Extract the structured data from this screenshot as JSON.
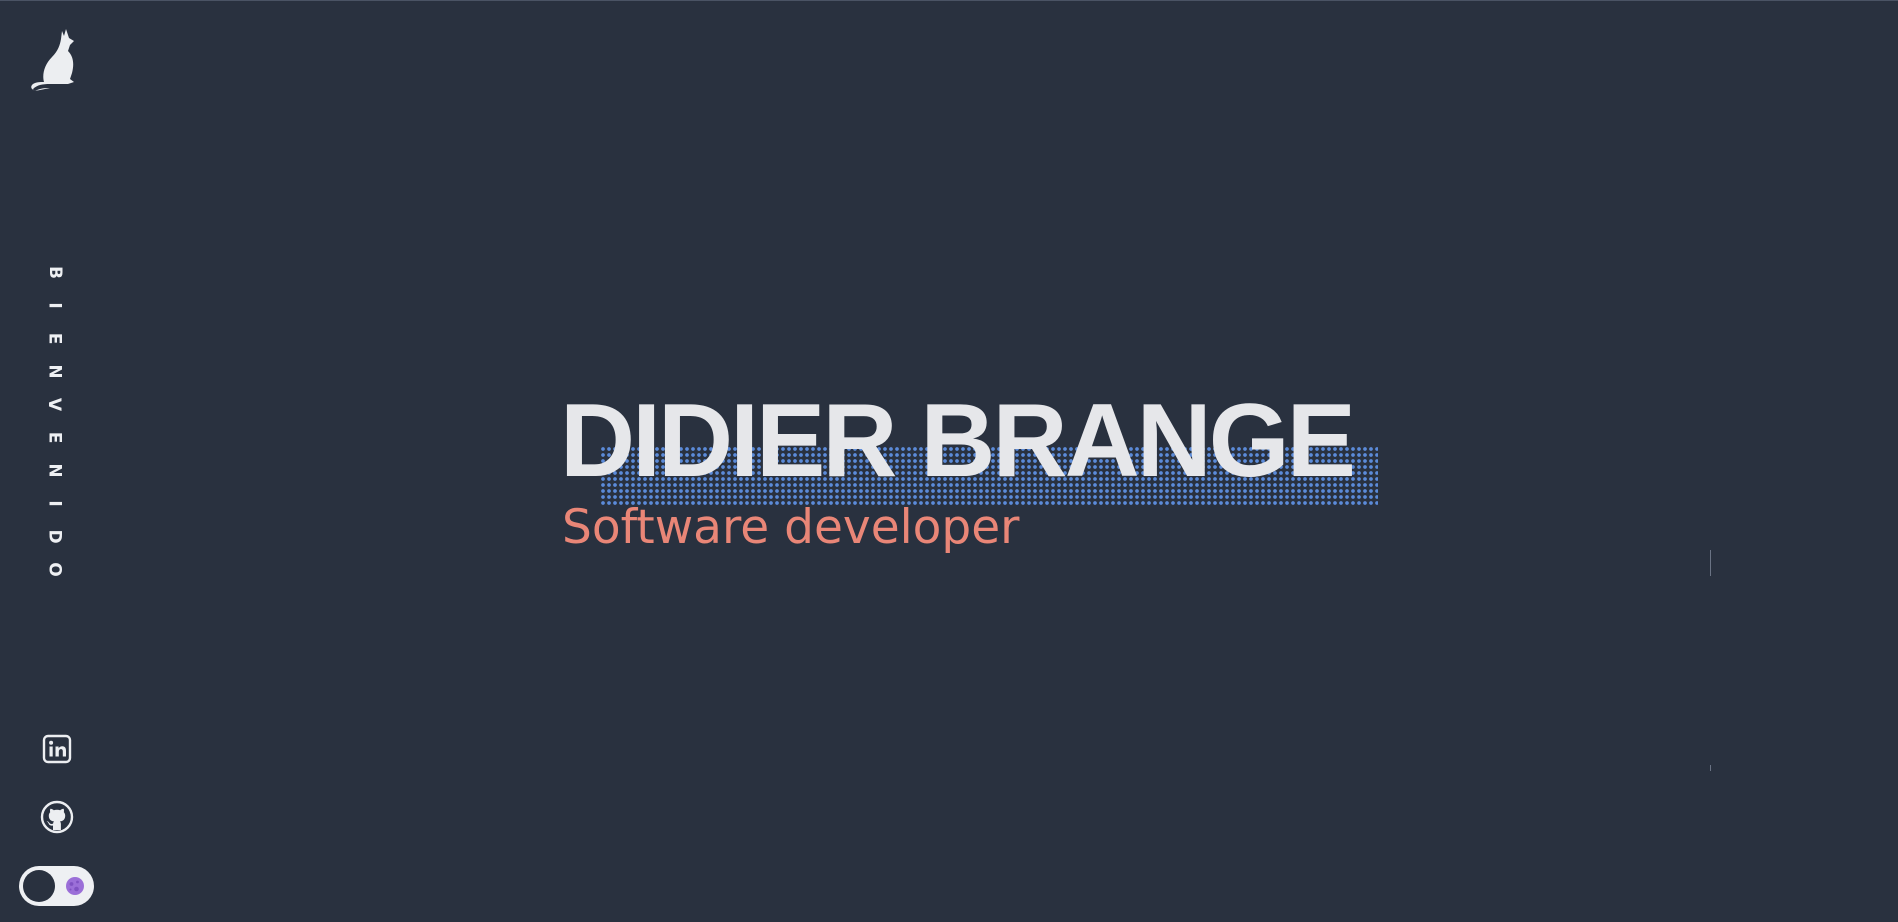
{
  "sidebar": {
    "logo_icon": "cat-silhouette-icon",
    "side_text": [
      "B",
      "I",
      "E",
      "N",
      "V",
      "E",
      "N",
      "I",
      "D",
      "O"
    ],
    "social": [
      {
        "name": "LinkedIn",
        "icon": "linkedin-icon"
      },
      {
        "name": "GitHub",
        "icon": "github-icon"
      }
    ],
    "theme_toggle": {
      "icon": "moon-icon",
      "state": "dark"
    }
  },
  "hero": {
    "name": "DIDIER BRANGE",
    "role": "Software developer"
  },
  "colors": {
    "background": "#29313f",
    "name_text": "#e6e7ea",
    "role_text": "#e98677",
    "dot_pattern": "#5b8bd9",
    "moon": "#9b6fd8"
  }
}
